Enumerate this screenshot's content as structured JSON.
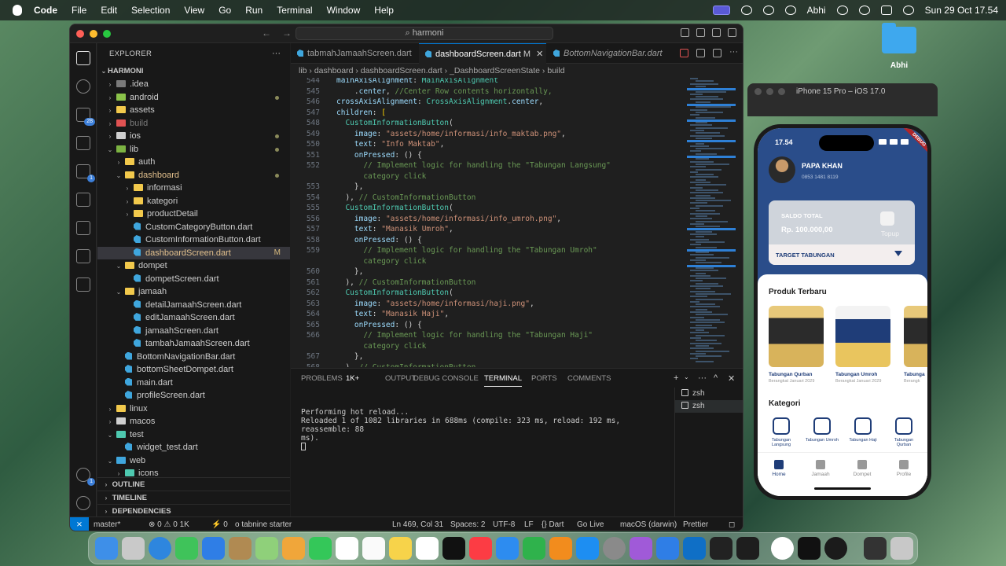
{
  "menubar": {
    "app": "Code",
    "items": [
      "File",
      "Edit",
      "Selection",
      "View",
      "Go",
      "Run",
      "Terminal",
      "Window",
      "Help"
    ],
    "user": "Abhi",
    "datetime": "Sun 29 Oct  17.54"
  },
  "window": {
    "search": "harmoni",
    "explorer_title": "EXPLORER",
    "project": "HARMONI"
  },
  "tree": [
    {
      "label": ".idea",
      "type": "folder",
      "indent": 1,
      "color": "#7a7a7a",
      "chev": "›"
    },
    {
      "label": "android",
      "type": "folder",
      "indent": 1,
      "color": "#8bc34a",
      "chev": "›",
      "dot": true
    },
    {
      "label": "assets",
      "type": "folder",
      "indent": 1,
      "color": "#f2c94c",
      "chev": "›"
    },
    {
      "label": "build",
      "type": "folder",
      "indent": 1,
      "color": "#e05252",
      "chev": "›",
      "dim": true
    },
    {
      "label": "ios",
      "type": "folder",
      "indent": 1,
      "color": "#cfcfcf",
      "chev": "›",
      "dot": true
    },
    {
      "label": "lib",
      "type": "folder",
      "indent": 1,
      "color": "#7cb342",
      "chev": "⌄",
      "dot": true
    },
    {
      "label": "auth",
      "type": "folder",
      "indent": 2,
      "color": "#f2c94c",
      "chev": "›"
    },
    {
      "label": "dashboard",
      "type": "folder",
      "indent": 2,
      "color": "#f2c94c",
      "chev": "⌄",
      "dot": true,
      "mod": true
    },
    {
      "label": "informasi",
      "type": "folder",
      "indent": 3,
      "color": "#f2c94c",
      "chev": "›"
    },
    {
      "label": "kategori",
      "type": "folder",
      "indent": 3,
      "color": "#f2c94c",
      "chev": "›"
    },
    {
      "label": "productDetail",
      "type": "folder",
      "indent": 3,
      "color": "#f2c94c",
      "chev": "›"
    },
    {
      "label": "CustomCategoryButton.dart",
      "type": "dart",
      "indent": 3
    },
    {
      "label": "CustomInformationButton.dart",
      "type": "dart",
      "indent": 3
    },
    {
      "label": "dashboardScreen.dart",
      "type": "dart",
      "indent": 3,
      "selected": true,
      "flag": "M",
      "mod": true
    },
    {
      "label": "dompet",
      "type": "folder",
      "indent": 2,
      "color": "#f2c94c",
      "chev": "⌄"
    },
    {
      "label": "dompetScreen.dart",
      "type": "dart",
      "indent": 3
    },
    {
      "label": "jamaah",
      "type": "folder",
      "indent": 2,
      "color": "#f2c94c",
      "chev": "⌄"
    },
    {
      "label": "detailJamaahScreen.dart",
      "type": "dart",
      "indent": 3
    },
    {
      "label": "editJamaahScreen.dart",
      "type": "dart",
      "indent": 3
    },
    {
      "label": "jamaahScreen.dart",
      "type": "dart",
      "indent": 3
    },
    {
      "label": "tambahJamaahScreen.dart",
      "type": "dart",
      "indent": 3
    },
    {
      "label": "BottomNavigationBar.dart",
      "type": "dart",
      "indent": 2
    },
    {
      "label": "bottomSheetDompet.dart",
      "type": "dart",
      "indent": 2
    },
    {
      "label": "main.dart",
      "type": "dart",
      "indent": 2
    },
    {
      "label": "profileScreen.dart",
      "type": "dart",
      "indent": 2
    },
    {
      "label": "linux",
      "type": "folder",
      "indent": 1,
      "color": "#f2c94c",
      "chev": "›"
    },
    {
      "label": "macos",
      "type": "folder",
      "indent": 1,
      "color": "#cfcfcf",
      "chev": "›"
    },
    {
      "label": "test",
      "type": "folder",
      "indent": 1,
      "color": "#4ec9b0",
      "chev": "⌄"
    },
    {
      "label": "widget_test.dart",
      "type": "dart",
      "indent": 2
    },
    {
      "label": "web",
      "type": "folder",
      "indent": 1,
      "color": "#3fa6dd",
      "chev": "⌄"
    },
    {
      "label": "icons",
      "type": "folder",
      "indent": 2,
      "color": "#4ec9b0",
      "chev": "›"
    }
  ],
  "sections": [
    "OUTLINE",
    "TIMELINE",
    "DEPENDENCIES"
  ],
  "tabs": [
    {
      "label": "tabmahJamaahScreen.dart",
      "active": false
    },
    {
      "label": "dashboardScreen.dart",
      "active": true,
      "flag": "M"
    },
    {
      "label": "BottomNavigationBar.dart",
      "active": false
    }
  ],
  "breadcrumb": "lib  ›  dashboard  ›  dashboardScreen.dart  ›  _DashboardScreenState  ›  build",
  "code_lines": [
    {
      "n": "544",
      "html": "<span class=\"kw\">mainAxisAlignment</span>: <span class=\"cls\">MainAxisAlignment</span>"
    },
    {
      "n": "545",
      "html": "    .<span class=\"kw\">center</span>, <span class=\"cm\">//Center Row contents horizontally,</span>"
    },
    {
      "n": "546",
      "html": "<span class=\"kw\">crossAxisAlignment</span>: <span class=\"cls\">CrossAxisAlignment</span>.<span class=\"kw\">center</span>,"
    },
    {
      "n": "547",
      "html": "<span class=\"kw\">children</span>: <span class=\"punc\">[</span>"
    },
    {
      "n": "548",
      "html": "  <span class=\"cls\">CustomInformationButton</span>("
    },
    {
      "n": "549",
      "html": "    <span class=\"kw\">image</span>: <span class=\"str\">\"assets/home/informasi/info_maktab.png\"</span>,"
    },
    {
      "n": "550",
      "html": "    <span class=\"kw\">text</span>: <span class=\"str\">\"Info Maktab\"</span>,"
    },
    {
      "n": "551",
      "html": "    <span class=\"kw\">onPressed</span>: () {"
    },
    {
      "n": "552",
      "html": "      <span class=\"cm\">// Implement logic for handling the \"Tabungan Langsung\"</span>"
    },
    {
      "n": "",
      "html": "      <span class=\"cm\">category click</span>"
    },
    {
      "n": "553",
      "html": "    },"
    },
    {
      "n": "554",
      "html": "  ), <span class=\"cm\">// CustomInformationButton</span>"
    },
    {
      "n": "555",
      "html": "  <span class=\"cls\">CustomInformationButton</span>("
    },
    {
      "n": "556",
      "html": "    <span class=\"kw\">image</span>: <span class=\"str\">\"assets/home/informasi/info_umroh.png\"</span>,"
    },
    {
      "n": "557",
      "html": "    <span class=\"kw\">text</span>: <span class=\"str\">\"Manasik Umroh\"</span>,"
    },
    {
      "n": "558",
      "html": "    <span class=\"kw\">onPressed</span>: () {"
    },
    {
      "n": "559",
      "html": "      <span class=\"cm\">// Implement logic for handling the \"Tabungan Umroh\"</span>"
    },
    {
      "n": "",
      "html": "      <span class=\"cm\">category click</span>"
    },
    {
      "n": "560",
      "html": "    },"
    },
    {
      "n": "561",
      "html": "  ), <span class=\"cm\">// CustomInformationButton</span>"
    },
    {
      "n": "562",
      "html": "  <span class=\"cls\">CustomInformationButton</span>("
    },
    {
      "n": "563",
      "html": "    <span class=\"kw\">image</span>: <span class=\"str\">\"assets/home/informasi/haji.png\"</span>,"
    },
    {
      "n": "564",
      "html": "    <span class=\"kw\">text</span>: <span class=\"str\">\"Manasik Haji\"</span>,"
    },
    {
      "n": "565",
      "html": "    <span class=\"kw\">onPressed</span>: () {"
    },
    {
      "n": "566",
      "html": "      <span class=\"cm\">// Implement logic for handling the \"Tabungan Haji\"</span>"
    },
    {
      "n": "",
      "html": "      <span class=\"cm\">category click</span>"
    },
    {
      "n": "567",
      "html": "    },"
    },
    {
      "n": "568",
      "html": "  ), <span class=\"cm\">// CustomInformationButton</span>"
    }
  ],
  "panel": {
    "tabs": [
      "PROBLEMS",
      "OUTPUT",
      "DEBUG CONSOLE",
      "TERMINAL",
      "PORTS",
      "COMMENTS"
    ],
    "problems_count": "1K+",
    "active": "TERMINAL",
    "terminal_lines": [
      "Performing hot reload...",
      "Reloaded 1 of 1082 libraries in 688ms (compile: 323 ms, reload: 192 ms, reassemble: 88",
      "ms)."
    ],
    "terminals": [
      "zsh",
      "zsh"
    ]
  },
  "status": {
    "branch": "master*",
    "errors": "⊗ 0 ⚠ 0  1K",
    "ports": "⚡ 0",
    "tabnine": "o tabnine starter",
    "position": "Ln 469, Col 31",
    "spaces": "Spaces: 2",
    "encoding": "UTF-8",
    "eol": "LF",
    "lang": "{} Dart",
    "golive": "Go Live",
    "device": "macOS (darwin)",
    "prettier": "Prettier"
  },
  "desktop": {
    "folder_label": "Abhi"
  },
  "simulator": {
    "title": "iPhone 15 Pro – iOS 17.0",
    "time": "17.54",
    "debug": "DEBUG",
    "user_name": "PAPA KHAN",
    "user_phone": "0853 1481 8119",
    "saldo_label": "SALDO TOTAL",
    "saldo_amount": "Rp. 100.000,00",
    "topup": "Topup",
    "target": "TARGET TABUNGAN",
    "produk_title": "Produk Terbaru",
    "products": [
      {
        "name": "Tabungan Qurban",
        "sub": "Berangkat Januari 2029"
      },
      {
        "name": "Tabungan Umroh",
        "sub": "Berangkat Januari 2029"
      },
      {
        "name": "Tabunga",
        "sub": "Berangk"
      }
    ],
    "kategori_title": "Kategori",
    "kategori": [
      "Tabungan Langsung",
      "Tabungan Umroh",
      "Tabungan Haji",
      "Tabungan Qurban"
    ],
    "nav": [
      "Home",
      "Jamaah",
      "Dompet",
      "Profile"
    ]
  }
}
